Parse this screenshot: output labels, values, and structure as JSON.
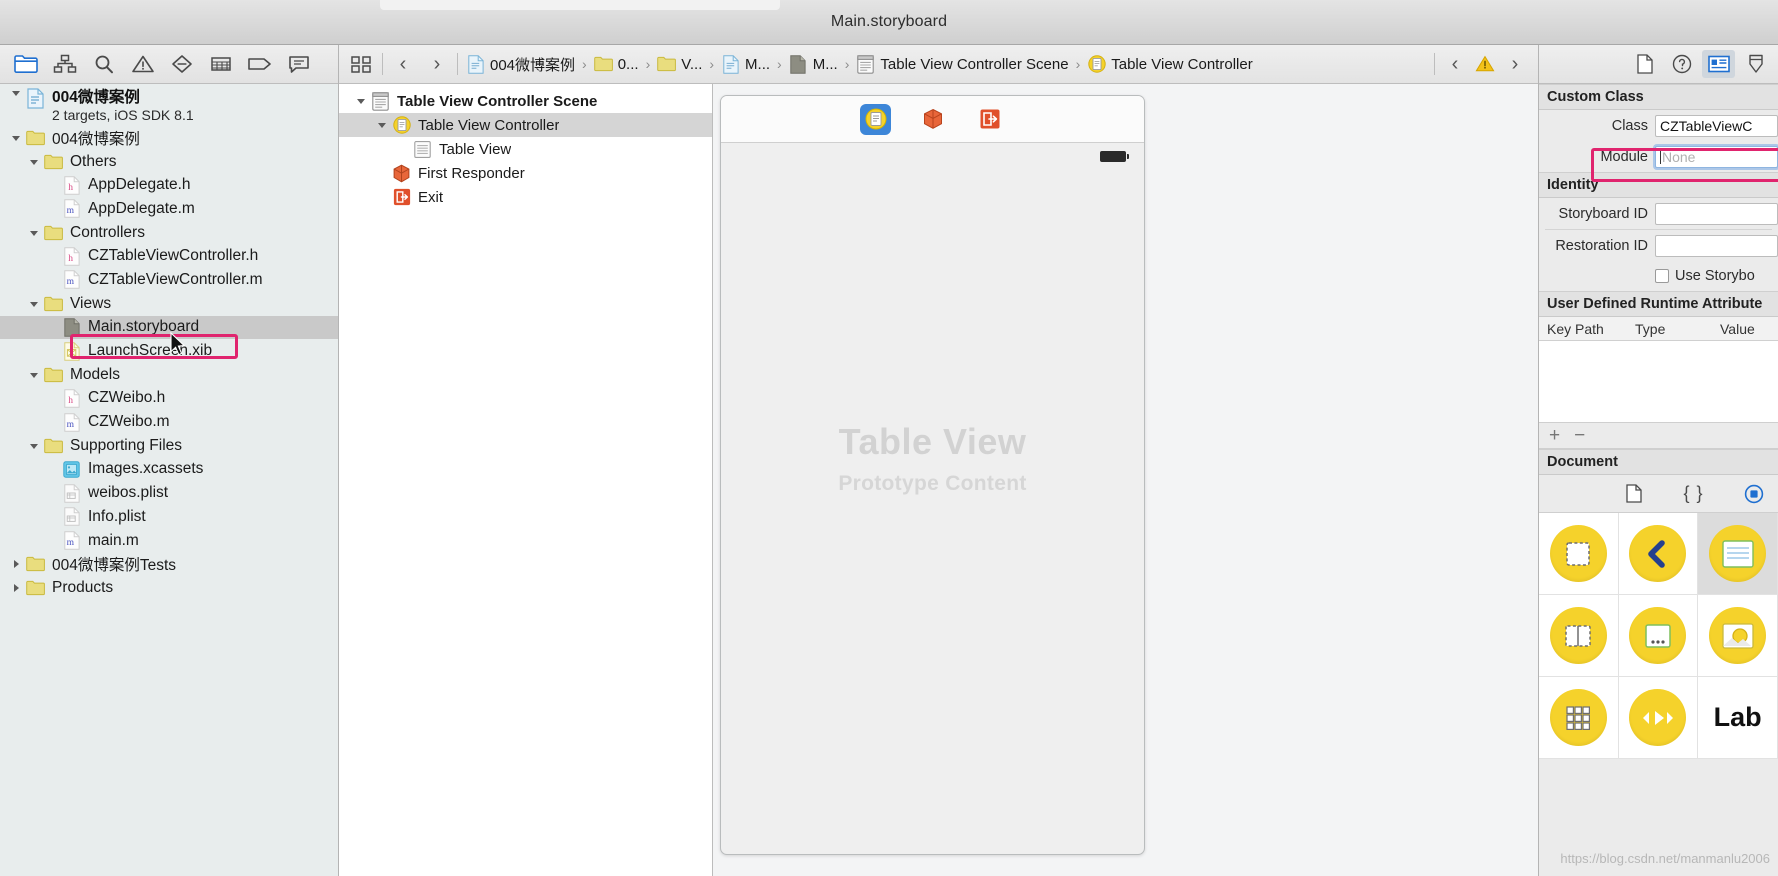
{
  "window": {
    "title": "Main.storyboard"
  },
  "navigator": {
    "toolbar_icons": [
      {
        "name": "folder-icon",
        "label": "Project navigator"
      },
      {
        "name": "hierarchy-icon",
        "label": "Symbol navigator"
      },
      {
        "name": "search-icon",
        "label": "Find navigator"
      },
      {
        "name": "warning-triangle-icon",
        "label": "Issue navigator"
      },
      {
        "name": "test-diamond-icon",
        "label": "Test navigator"
      },
      {
        "name": "debug-grid-icon",
        "label": "Debug navigator"
      },
      {
        "name": "breakpoint-tag-icon",
        "label": "Breakpoint navigator"
      },
      {
        "name": "report-log-icon",
        "label": "Report navigator"
      }
    ],
    "project": {
      "name": "004微博案例",
      "subtitle": "2 targets, iOS SDK 8.1"
    },
    "items": [
      {
        "label": "004微博案例",
        "icon": "folder",
        "indent": 1,
        "disclosure": "open",
        "selected": false
      },
      {
        "label": "Others",
        "icon": "folder",
        "indent": 2,
        "disclosure": "open",
        "selected": false
      },
      {
        "label": "AppDelegate.h",
        "icon": "h-file",
        "indent": 3,
        "disclosure": "none",
        "selected": false
      },
      {
        "label": "AppDelegate.m",
        "icon": "m-file",
        "indent": 3,
        "disclosure": "none",
        "selected": false
      },
      {
        "label": "Controllers",
        "icon": "folder",
        "indent": 2,
        "disclosure": "open",
        "selected": false
      },
      {
        "label": "CZTableViewController.h",
        "icon": "h-file",
        "indent": 3,
        "disclosure": "none",
        "selected": false
      },
      {
        "label": "CZTableViewController.m",
        "icon": "m-file",
        "indent": 3,
        "disclosure": "none",
        "selected": false
      },
      {
        "label": "Views",
        "icon": "folder",
        "indent": 2,
        "disclosure": "open",
        "selected": false
      },
      {
        "label": "Main.storyboard",
        "icon": "storyboard",
        "indent": 3,
        "disclosure": "none",
        "selected": true
      },
      {
        "label": "LaunchScreen.xib",
        "icon": "xib",
        "indent": 3,
        "disclosure": "none",
        "selected": false
      },
      {
        "label": "Models",
        "icon": "folder",
        "indent": 2,
        "disclosure": "open",
        "selected": false
      },
      {
        "label": "CZWeibo.h",
        "icon": "h-file",
        "indent": 3,
        "disclosure": "none",
        "selected": false
      },
      {
        "label": "CZWeibo.m",
        "icon": "m-file",
        "indent": 3,
        "disclosure": "none",
        "selected": false
      },
      {
        "label": "Supporting Files",
        "icon": "folder",
        "indent": 2,
        "disclosure": "open",
        "selected": false
      },
      {
        "label": "Images.xcassets",
        "icon": "xcassets",
        "indent": 3,
        "disclosure": "none",
        "selected": false
      },
      {
        "label": "weibos.plist",
        "icon": "plist",
        "indent": 3,
        "disclosure": "none",
        "selected": false
      },
      {
        "label": "Info.plist",
        "icon": "plist",
        "indent": 3,
        "disclosure": "none",
        "selected": false
      },
      {
        "label": "main.m",
        "icon": "m-file",
        "indent": 3,
        "disclosure": "none",
        "selected": false
      },
      {
        "label": "004微博案例Tests",
        "icon": "folder",
        "indent": 1,
        "disclosure": "closed",
        "selected": false
      },
      {
        "label": "Products",
        "icon": "folder",
        "indent": 1,
        "disclosure": "closed",
        "selected": false
      }
    ],
    "highlight_color": "#e0246e"
  },
  "jumpbar": {
    "related_icon": "related-items-icon",
    "back_label": "‹",
    "forward_label": "›",
    "breadcrumbs": [
      {
        "label": "004微博案例",
        "icon": "project-file"
      },
      {
        "label": "0...",
        "icon": "folder"
      },
      {
        "label": "V...",
        "icon": "folder"
      },
      {
        "label": "M...",
        "icon": "project-file"
      },
      {
        "label": "M...",
        "icon": "storyboard"
      },
      {
        "label": "Table View Controller Scene",
        "icon": "scene"
      },
      {
        "label": "Table View Controller",
        "icon": "view-controller"
      }
    ],
    "issue_prev": "‹",
    "issue_icon": "warning-triangle-icon",
    "issue_next": "›"
  },
  "outline": {
    "rows": [
      {
        "label": "Table View Controller Scene",
        "icon": "scene",
        "indent": 0,
        "disclosure": "open",
        "bold": true,
        "selected": false
      },
      {
        "label": "Table View Controller",
        "icon": "view-controller",
        "indent": 1,
        "disclosure": "open",
        "bold": false,
        "selected": true
      },
      {
        "label": "Table View",
        "icon": "table-view",
        "indent": 2,
        "disclosure": "none",
        "bold": false,
        "selected": false
      },
      {
        "label": "First Responder",
        "icon": "first-responder",
        "indent": 1,
        "disclosure": "none",
        "bold": false,
        "selected": false
      },
      {
        "label": "Exit",
        "icon": "exit",
        "indent": 1,
        "disclosure": "none",
        "bold": false,
        "selected": false
      }
    ]
  },
  "canvas": {
    "scene_icons": [
      {
        "name": "view-controller-icon",
        "selected": true
      },
      {
        "name": "first-responder-icon",
        "selected": false
      },
      {
        "name": "exit-icon",
        "selected": false
      }
    ],
    "table_view_title": "Table View",
    "table_view_subtitle": "Prototype Content"
  },
  "utilities": {
    "tabs": [
      {
        "name": "file-inspector-icon",
        "active": false
      },
      {
        "name": "quick-help-icon",
        "active": false
      },
      {
        "name": "identity-inspector-icon",
        "active": true
      },
      {
        "name": "attributes-inspector-icon",
        "active": false
      }
    ],
    "custom_class": {
      "heading": "Custom Class",
      "class_label": "Class",
      "class_value": "CZTableViewC",
      "module_label": "Module",
      "module_placeholder": "None"
    },
    "identity": {
      "heading": "Identity",
      "storyboard_id_label": "Storyboard ID",
      "storyboard_id_value": "",
      "restoration_id_label": "Restoration ID",
      "restoration_id_value": "",
      "use_storyboard_label": "Use Storybo",
      "use_storyboard_checked": false
    },
    "runtime_attributes": {
      "heading": "User Defined Runtime Attribute",
      "columns": [
        "Key Path",
        "Type",
        "Value"
      ],
      "rows": [],
      "add_label": "+",
      "remove_label": "−"
    },
    "document": {
      "heading": "Document"
    },
    "library_tabs": [
      {
        "name": "file-template-library-icon",
        "active": false
      },
      {
        "name": "code-snippet-library-icon",
        "active": false
      },
      {
        "name": "object-library-icon",
        "active": true
      }
    ],
    "library_items": [
      {
        "name": "view-controller-object",
        "kind": "dashed-square",
        "selected": false
      },
      {
        "name": "navigation-controller-object",
        "kind": "back-chevron",
        "selected": false
      },
      {
        "name": "table-view-controller-object",
        "kind": "lines-card",
        "selected": true
      },
      {
        "name": "split-view-controller-object",
        "kind": "split-square",
        "selected": false
      },
      {
        "name": "page-view-controller-object",
        "kind": "dots-square",
        "selected": false
      },
      {
        "name": "image-view-object",
        "kind": "photo-circle",
        "selected": false
      },
      {
        "name": "collection-view-controller-object",
        "kind": "grid-square",
        "selected": false
      },
      {
        "name": "avplayer-view-controller-object",
        "kind": "transport-controls",
        "selected": false
      },
      {
        "name": "label-object",
        "kind": "label-text",
        "selected": false,
        "text": "Lab"
      }
    ],
    "highlight_color": "#e0246e"
  },
  "watermark": "https://blog.csdn.net/manmanlu2006"
}
